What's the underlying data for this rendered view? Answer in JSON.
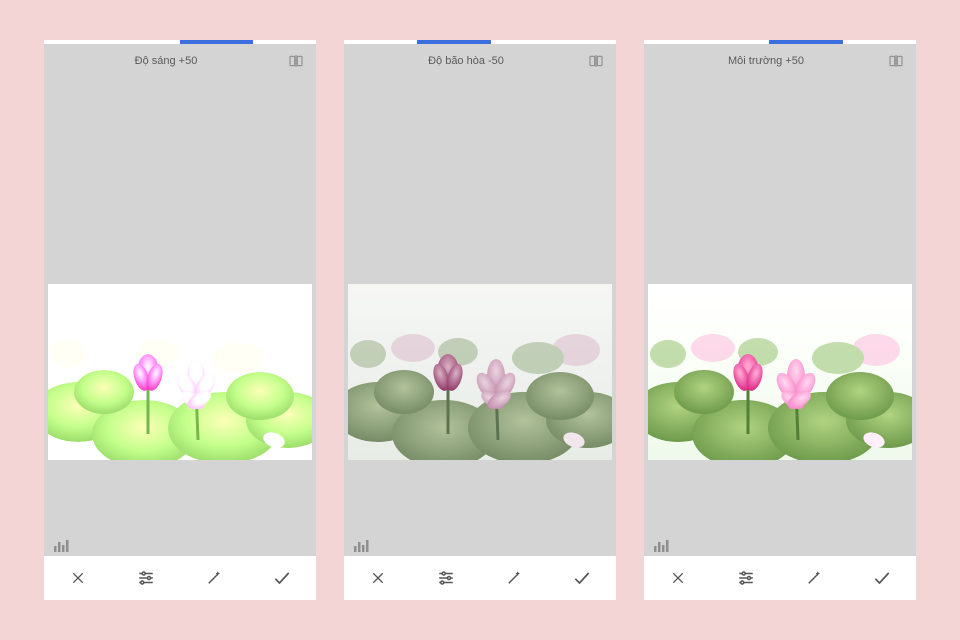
{
  "panels": [
    {
      "label": "Độ sáng +50",
      "track": {
        "left_pct": 50,
        "width_pct": 27
      },
      "filter": {
        "brightness": 1.5,
        "saturate": 1.0
      }
    },
    {
      "label": "Độ bão hòa -50",
      "track": {
        "left_pct": 27,
        "width_pct": 27
      },
      "filter": {
        "brightness": 1.0,
        "saturate": 0.5
      }
    },
    {
      "label": "Môi trường +50",
      "track": {
        "left_pct": 46,
        "width_pct": 27
      },
      "filter": {
        "brightness": 1.05,
        "saturate": 1.0
      }
    }
  ],
  "icons": {
    "compare": "compare-icon",
    "histogram": "histogram-icon",
    "cancel": "close-icon",
    "tune": "sliders-icon",
    "magic": "wand-icon",
    "confirm": "check-icon"
  }
}
